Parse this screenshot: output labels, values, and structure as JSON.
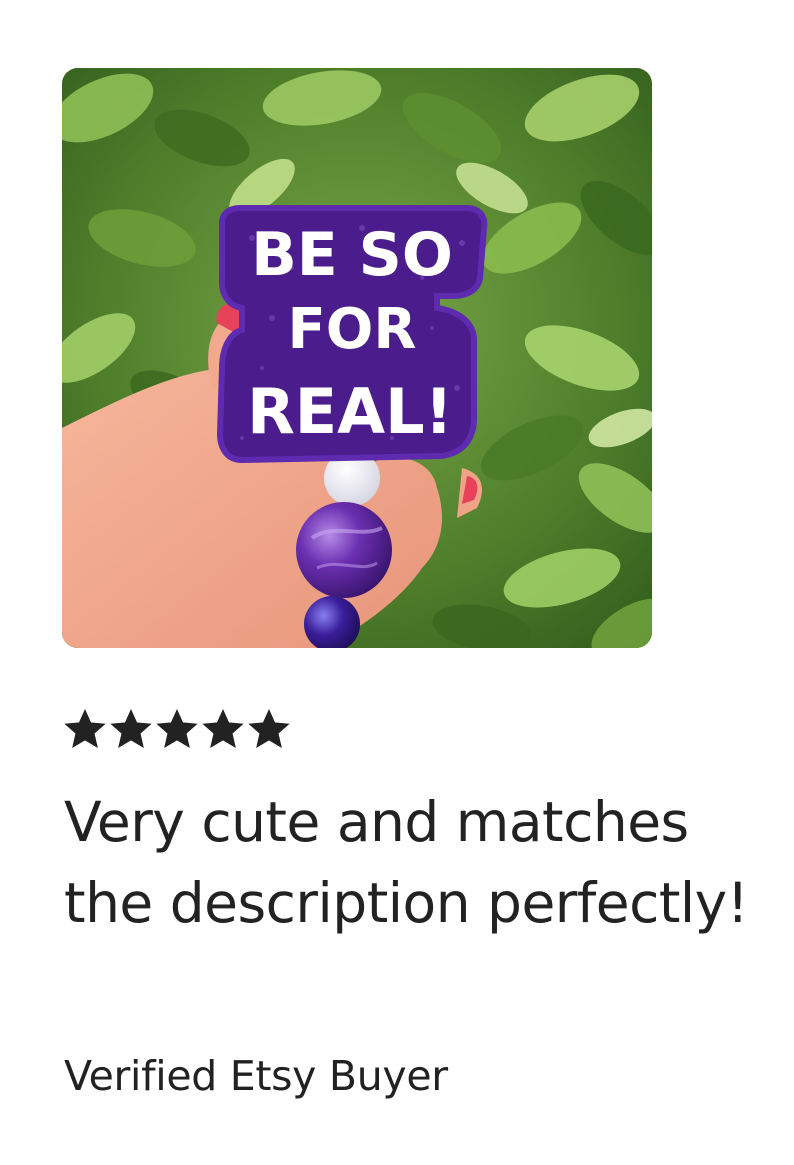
{
  "review": {
    "photo": {
      "sign_lines": [
        "BE SO",
        "FOR",
        "REAL!"
      ],
      "colors": {
        "badge": "#4a1c8c",
        "badge_text": "#ffffff",
        "foliage": "#5b8a33",
        "skin": "#f0a58a",
        "nail": "#e8415a",
        "bead_large": "#6b2fb0",
        "bead_small": "#3a1e9a",
        "bead_white": "#f2f2f6"
      }
    },
    "rating": 5,
    "rating_max": 5,
    "star_color": "#222222",
    "text": "Very cute and matches the description perfectly!",
    "reviewer": "Verified Etsy Buyer"
  }
}
